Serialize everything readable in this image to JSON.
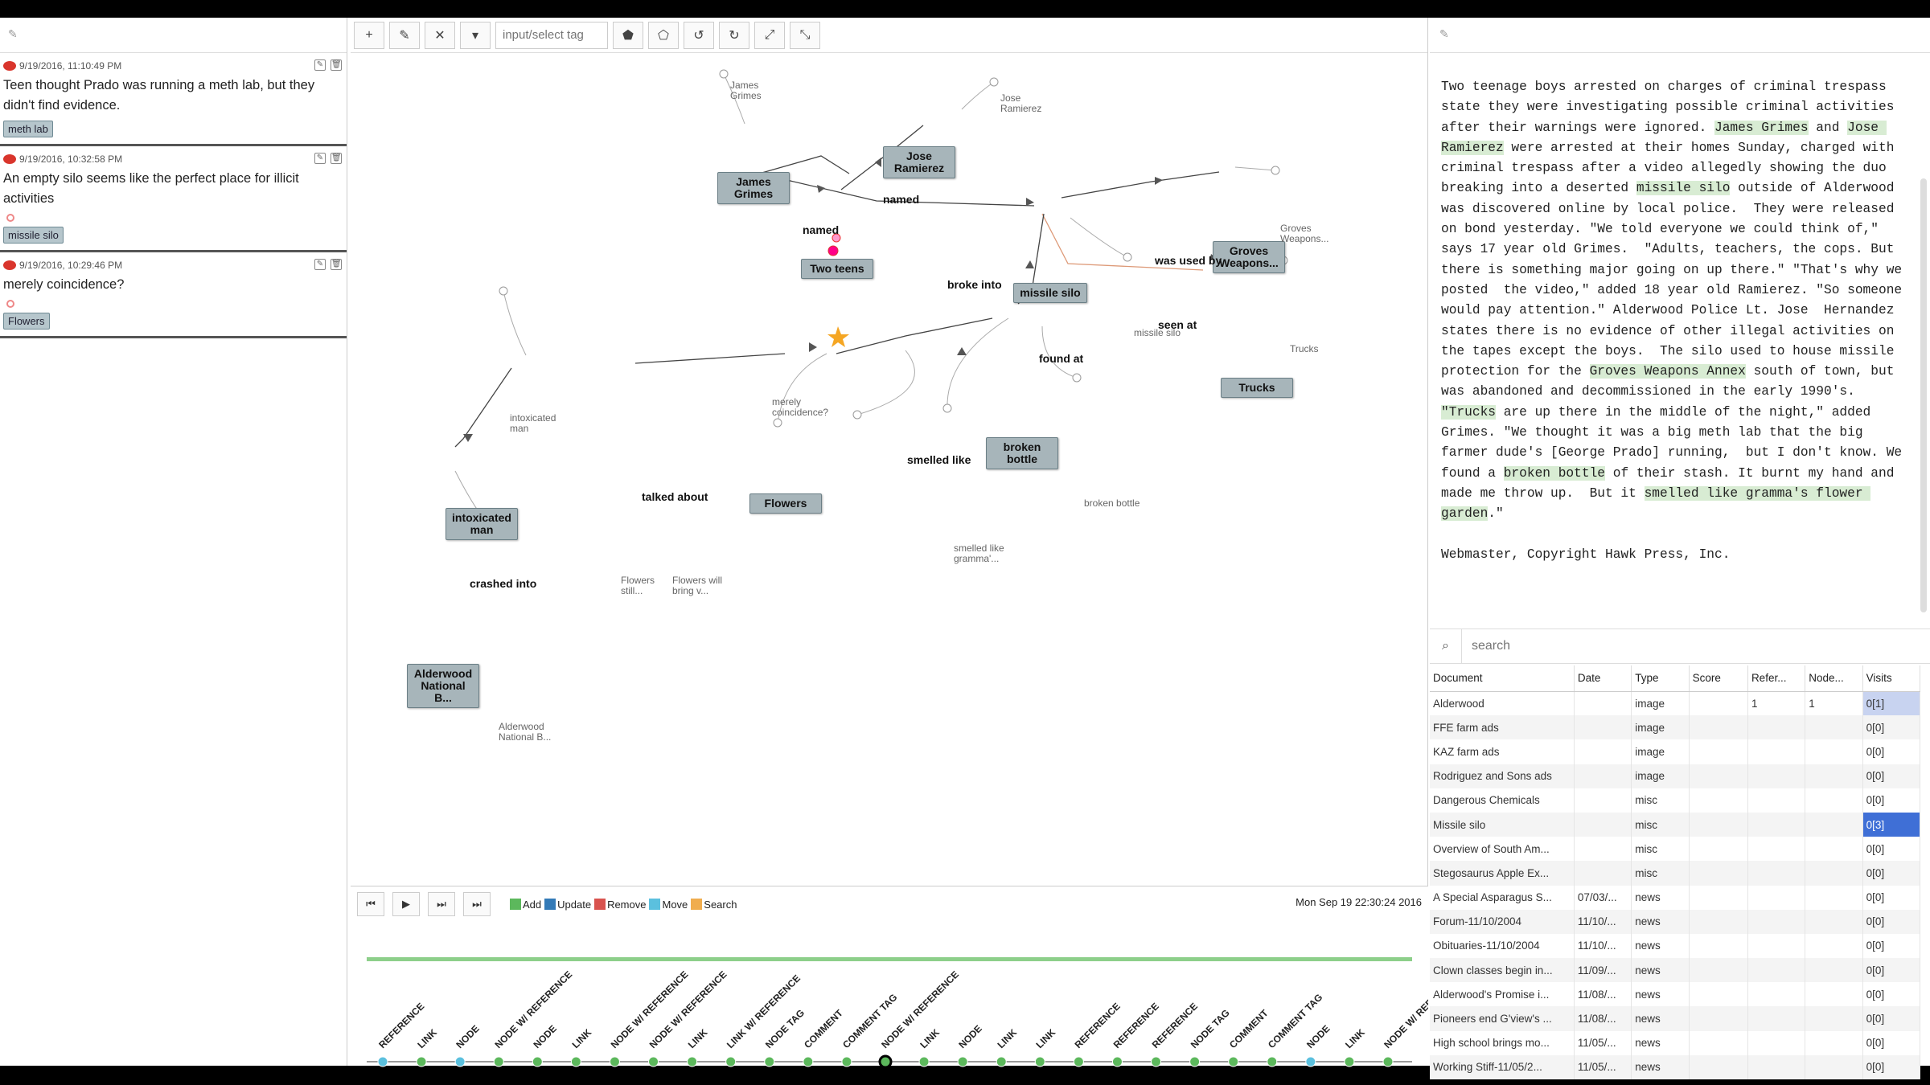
{
  "comments": [
    {
      "timestamp": "9/19/2016, 11:10:49 PM",
      "text": "Teen thought Prado was running a meth lab, but they didn't find evidence.",
      "tag": "meth lab"
    },
    {
      "timestamp": "9/19/2016, 10:32:58 PM",
      "text": "An empty silo seems like the perfect place for illicit activities",
      "tag": "missile silo"
    },
    {
      "timestamp": "9/19/2016, 10:29:46 PM",
      "text": "merely coincidence?",
      "tag": "Flowers"
    }
  ],
  "toolbar": {
    "add": "+",
    "edit": "✎",
    "remove": "✕",
    "dropdown": "▾",
    "tag_placeholder": "input/select tag",
    "undo": "↺",
    "redo": "↻",
    "expand": "⤢",
    "collapse": "⤡"
  },
  "graph": {
    "nodes": [
      {
        "label": "James Grimes"
      },
      {
        "label": "Jose Ramierez"
      },
      {
        "label": "Two teens"
      },
      {
        "label": "missile silo"
      },
      {
        "label": "Groves Weapons..."
      },
      {
        "label": "Trucks"
      },
      {
        "label": "broken bottle"
      },
      {
        "label": "Flowers"
      },
      {
        "label": "intoxicated man"
      },
      {
        "label": "Alderwood National B..."
      }
    ],
    "edges": [
      "named",
      "named",
      "broke into",
      "was used by",
      "seen at",
      "found at",
      "smelled like",
      "talked about",
      "crashed into"
    ],
    "refs": [
      "James Grimes",
      "Jose Ramierez",
      "Groves Weapons...",
      "missile silo",
      "Trucks",
      "merely coincidence?",
      "intoxicated man",
      "broken bottle",
      "smelled like gramma'...",
      "Flowers still...",
      "Flowers will bring v...",
      "Alderwood National B..."
    ]
  },
  "timeline": {
    "controls": {
      "rewind": "⏮",
      "play": "▶",
      "forward": "⏭",
      "end": "⏭"
    },
    "legend": [
      {
        "label": "Add",
        "color": "#5cb85c"
      },
      {
        "label": "Update",
        "color": "#337ab7"
      },
      {
        "label": "Remove",
        "color": "#d9534f"
      },
      {
        "label": "Move",
        "color": "#5bc0de"
      },
      {
        "label": "Search",
        "color": "#f0ad4e"
      }
    ],
    "date": "Mon Sep 19 22:30:24 2016",
    "events": [
      "REFERENCE",
      "LINK",
      "NODE",
      "NODE W/ REFERENCE",
      "NODE",
      "LINK",
      "NODE W/ REFERENCE",
      "NODE W/ REFERENCE",
      "LINK",
      "LINK W/ REFERENCE",
      "NODE TAG",
      "COMMENT",
      "COMMENT TAG",
      "NODE W/ REFERENCE",
      "LINK",
      "NODE",
      "LINK",
      "LINK",
      "REFERENCE",
      "REFERENCE",
      "REFERENCE",
      "NODE TAG",
      "COMMENT",
      "COMMENT TAG",
      "NODE",
      "LINK",
      "NODE W/ REFERENCE"
    ]
  },
  "document": {
    "text_parts": [
      {
        "t": "Two teenage boys arrested on charges of criminal trespass state they were investigating possible criminal activities after their warnings were ignored. "
      },
      {
        "t": "James Grimes",
        "hl": true
      },
      {
        "t": " and "
      },
      {
        "t": "Jose Ramierez",
        "hl": true
      },
      {
        "t": " were arrested at their homes Sunday, charged with criminal trespass after a video allegedly showing the duo  breaking into a deserted "
      },
      {
        "t": "missile silo",
        "hl": true
      },
      {
        "t": " outside of Alderwood was discovered online by local police.  They were released on bond yesterday. \"We told everyone we could think of,\" says 17 year old Grimes.  \"Adults, teachers, the cops. But there is something major going on up there.\" \"That's why we posted  the video,\" added 18 year old Ramierez. \"So someone would pay attention.\" Alderwood Police Lt. Jose  Hernandez states there is no evidence of other illegal activities on the tapes except the boys.  The silo used to house missile protection for the "
      },
      {
        "t": "Groves Weapons Annex",
        "hl": true
      },
      {
        "t": " south of town, but was abandoned and decommissioned in the early 1990's. "
      },
      {
        "t": "\"Trucks",
        "hl": true
      },
      {
        "t": " are up there in the middle of the night,\" added Grimes. \"We thought it was a big meth lab that the big farmer dude's [George Prado] running,  but I don't know. We found a "
      },
      {
        "t": "broken bottle",
        "hl": true
      },
      {
        "t": " of their stash. It burnt my hand and made me throw up.  But it "
      },
      {
        "t": "smelled like gramma's flower garden",
        "hl": true
      },
      {
        "t": ".\"\n\nWebmaster, Copyright Hawk Press, Inc."
      }
    ],
    "search_placeholder": "search",
    "columns": [
      "Document",
      "Date",
      "Type",
      "Score",
      "Refer...",
      "Node...",
      "Visits"
    ],
    "rows": [
      {
        "doc": "Alderwood",
        "date": "",
        "type": "image",
        "score": "",
        "refs": "1",
        "nodes": "1",
        "visits": "0[1]",
        "vstate": "hi"
      },
      {
        "doc": "FFE farm ads",
        "date": "",
        "type": "image",
        "score": "",
        "refs": "",
        "nodes": "",
        "visits": "0[0]"
      },
      {
        "doc": "KAZ farm ads",
        "date": "",
        "type": "image",
        "score": "",
        "refs": "",
        "nodes": "",
        "visits": "0[0]"
      },
      {
        "doc": "Rodriguez and Sons ads",
        "date": "",
        "type": "image",
        "score": "",
        "refs": "",
        "nodes": "",
        "visits": "0[0]"
      },
      {
        "doc": "Dangerous Chemicals",
        "date": "",
        "type": "misc",
        "score": "",
        "refs": "",
        "nodes": "",
        "visits": "0[0]"
      },
      {
        "doc": "Missile silo",
        "date": "",
        "type": "misc",
        "score": "",
        "refs": "",
        "nodes": "",
        "visits": "0[3]",
        "vstate": "on"
      },
      {
        "doc": "Overview of South Am...",
        "date": "",
        "type": "misc",
        "score": "",
        "refs": "",
        "nodes": "",
        "visits": "0[0]"
      },
      {
        "doc": "Stegosaurus Apple Ex...",
        "date": "",
        "type": "misc",
        "score": "",
        "refs": "",
        "nodes": "",
        "visits": "0[0]"
      },
      {
        "doc": "A Special Asparagus S...",
        "date": "07/03/...",
        "type": "news",
        "score": "",
        "refs": "",
        "nodes": "",
        "visits": "0[0]"
      },
      {
        "doc": "Forum-11/10/2004",
        "date": "11/10/...",
        "type": "news",
        "score": "",
        "refs": "",
        "nodes": "",
        "visits": "0[0]"
      },
      {
        "doc": "Obituaries-11/10/2004",
        "date": "11/10/...",
        "type": "news",
        "score": "",
        "refs": "",
        "nodes": "",
        "visits": "0[0]"
      },
      {
        "doc": "Clown classes begin in...",
        "date": "11/09/...",
        "type": "news",
        "score": "",
        "refs": "",
        "nodes": "",
        "visits": "0[0]"
      },
      {
        "doc": "Alderwood's Promise i...",
        "date": "11/08/...",
        "type": "news",
        "score": "",
        "refs": "",
        "nodes": "",
        "visits": "0[0]"
      },
      {
        "doc": "Pioneers end G'view's ...",
        "date": "11/08/...",
        "type": "news",
        "score": "",
        "refs": "",
        "nodes": "",
        "visits": "0[0]"
      },
      {
        "doc": "High school brings mo...",
        "date": "11/05/...",
        "type": "news",
        "score": "",
        "refs": "",
        "nodes": "",
        "visits": "0[0]"
      },
      {
        "doc": "Working Stiff-11/05/2...",
        "date": "11/05/...",
        "type": "news",
        "score": "",
        "refs": "",
        "nodes": "",
        "visits": "0[0]"
      }
    ]
  }
}
